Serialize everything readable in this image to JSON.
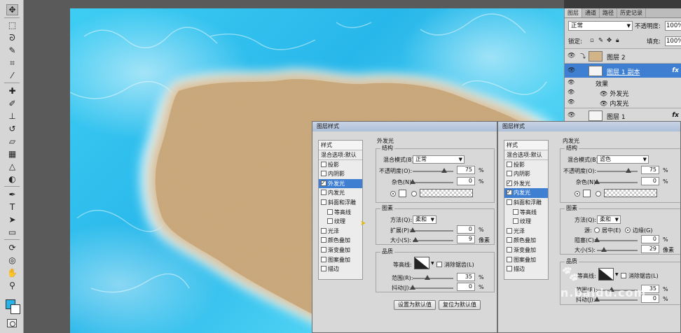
{
  "toolbar": {
    "tools": [
      "move-tool",
      "marquee-tool",
      "lasso-tool",
      "quick-select-tool",
      "crop-tool",
      "eyedropper-tool",
      "healing-tool",
      "brush-tool",
      "stamp-tool",
      "history-brush-tool",
      "eraser-tool",
      "gradient-tool",
      "blur-tool",
      "dodge-tool",
      "pen-tool",
      "type-tool",
      "path-select-tool",
      "shape-tool",
      "3d-rotate-tool",
      "3d-orbit-tool",
      "hand-tool",
      "zoom-tool"
    ],
    "foreground_color": "#27b2e8",
    "background_color": "#ffffff"
  },
  "layers_panel": {
    "tabs": [
      "图层",
      "通道",
      "路径",
      "历史记录"
    ],
    "blend_mode": "正常",
    "opacity_label": "不透明度:",
    "opacity_value": "100%",
    "lock_label": "锁定:",
    "fill_label": "填充:",
    "fill_value": "100%",
    "layers": [
      {
        "name": "图层 2"
      },
      {
        "name": "图层 1 副本",
        "fx": "fx"
      },
      {
        "name": "效果"
      },
      {
        "name": "外发光"
      },
      {
        "name": "内发光"
      },
      {
        "name": "图层 1",
        "fx": "fx"
      }
    ]
  },
  "dialog_outer": {
    "title": "图层样式",
    "style_header": "样式",
    "blend_default": "混合选项:默认",
    "items": [
      {
        "label": "投影",
        "checked": false
      },
      {
        "label": "内阴影",
        "checked": false
      },
      {
        "label": "外发光",
        "checked": true
      },
      {
        "label": "内发光",
        "checked": false
      },
      {
        "label": "斜面和浮雕",
        "checked": false
      },
      {
        "label": "等高线",
        "checked": false
      },
      {
        "label": "纹理",
        "checked": false
      },
      {
        "label": "光泽",
        "checked": false
      },
      {
        "label": "颜色叠加",
        "checked": false
      },
      {
        "label": "渐变叠加",
        "checked": false
      },
      {
        "label": "图案叠加",
        "checked": false
      },
      {
        "label": "描边",
        "checked": false
      }
    ],
    "panel_title": "外发光",
    "structure_label": "结构",
    "blend_mode_label": "混合模式(B):",
    "blend_mode_value": "正常",
    "opacity_label": "不透明度(O):",
    "opacity_value": "75",
    "noise_label": "杂色(N):",
    "noise_value": "0",
    "elements_label": "图素",
    "method_label": "方法(Q):",
    "method_value": "柔和",
    "spread_label": "扩展(P):",
    "spread_value": "0",
    "size_label": "大小(S):",
    "size_value": "9",
    "quality_label": "品质",
    "contour_label": "等高线:",
    "antialias_label": "消除锯齿(L)",
    "range_label": "范围(R):",
    "range_value": "35",
    "jitter_label": "抖动(J):",
    "jitter_value": "0",
    "percent": "%",
    "pixels": "像素",
    "set_default": "设置为默认值",
    "reset_default": "复位为默认值"
  },
  "dialog_inner": {
    "title": "图层样式",
    "style_header": "样式",
    "blend_default": "混合选项:默认",
    "items": [
      {
        "label": "投影",
        "checked": false
      },
      {
        "label": "内阴影",
        "checked": false
      },
      {
        "label": "外发光",
        "checked": true
      },
      {
        "label": "内发光",
        "checked": true
      },
      {
        "label": "斜面和浮雕",
        "checked": false
      },
      {
        "label": "等高线",
        "checked": false
      },
      {
        "label": "纹理",
        "checked": false
      },
      {
        "label": "光泽",
        "checked": false
      },
      {
        "label": "颜色叠加",
        "checked": false
      },
      {
        "label": "渐变叠加",
        "checked": false
      },
      {
        "label": "图案叠加",
        "checked": false
      },
      {
        "label": "描边",
        "checked": false
      }
    ],
    "panel_title": "内发光",
    "structure_label": "结构",
    "blend_mode_label": "混合模式(B):",
    "blend_mode_value": "滤色",
    "opacity_label": "不透明度(O):",
    "opacity_value": "75",
    "noise_label": "杂色(N):",
    "noise_value": "0",
    "elements_label": "图素",
    "method_label": "方法(Q):",
    "method_value": "柔和",
    "source_label": "源:",
    "source_center": "居中(E)",
    "source_edge": "边缘(G)",
    "choke_label": "阻塞(C):",
    "choke_value": "0",
    "size_label": "大小(S):",
    "size_value": "29",
    "quality_label": "品质",
    "contour_label": "等高线:",
    "antialias_label": "消除锯齿(L)",
    "range_label": "范围(R):",
    "range_value": "35",
    "jitter_label": "抖动(J):",
    "jitter_value": "0",
    "percent": "%",
    "pixels": "像素"
  },
  "watermark": "n.baidu.com"
}
